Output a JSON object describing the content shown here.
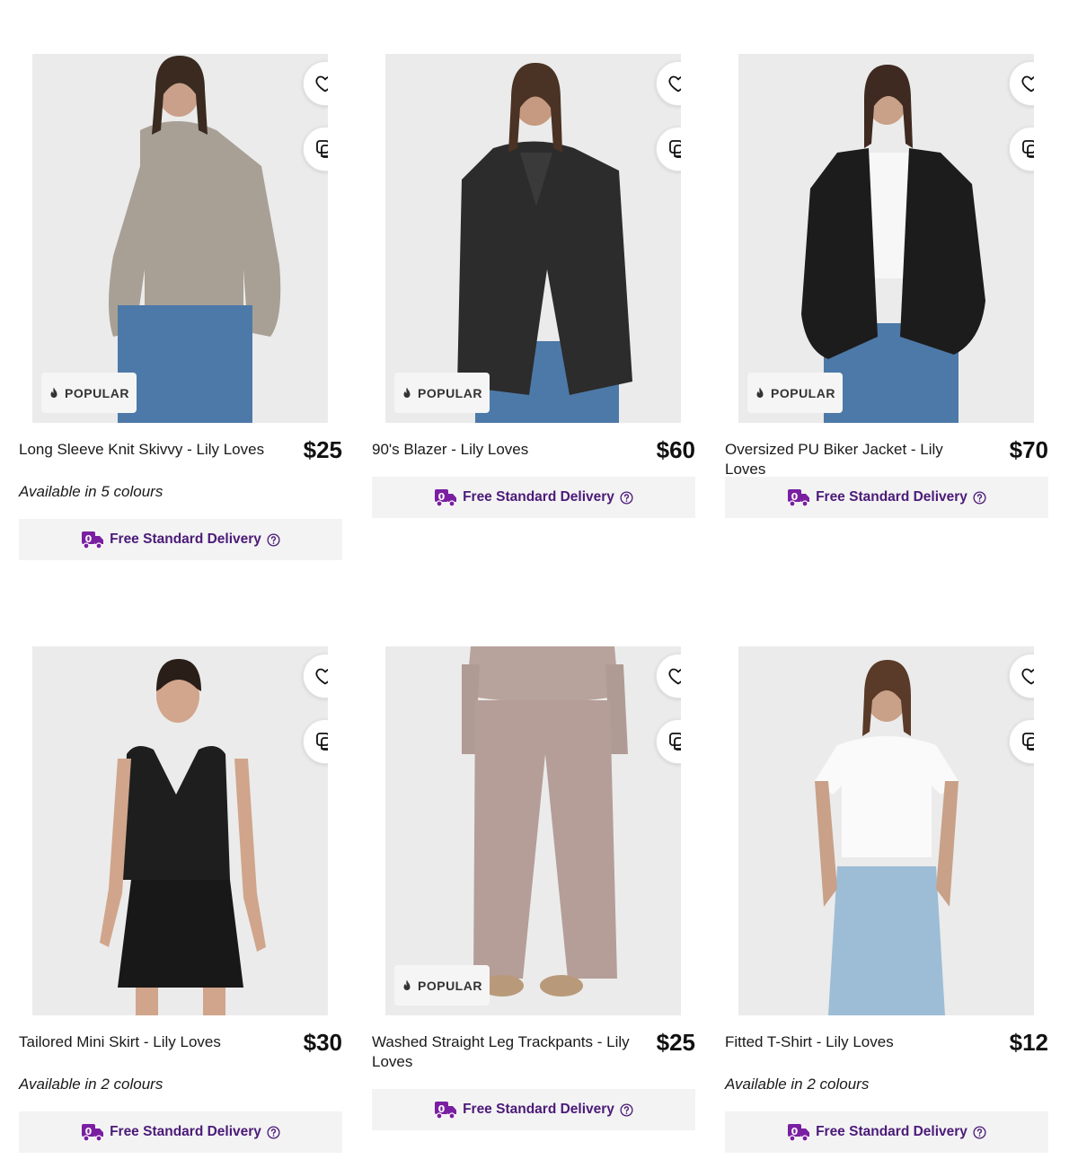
{
  "colors": {
    "delivery_purple": "#4b1a78",
    "delivery_icon": "#7a1fa2"
  },
  "products": [
    {
      "name": "Long Sleeve Knit Skivvy - Lily Loves",
      "price": "$25",
      "badge": "POPULAR",
      "colours": "Available in 5 colours",
      "delivery": "Free Standard Delivery",
      "icons": [
        "heart-icon",
        "compare-icon",
        "flame-icon",
        "delivery-truck-icon",
        "help-circle-icon"
      ]
    },
    {
      "name": "90's Blazer - Lily Loves",
      "price": "$60",
      "badge": "POPULAR",
      "colours": "",
      "delivery": "Free Standard Delivery",
      "icons": [
        "heart-icon",
        "compare-icon",
        "flame-icon",
        "delivery-truck-icon",
        "help-circle-icon"
      ]
    },
    {
      "name": "Oversized PU Biker Jacket - Lily Loves",
      "price": "$70",
      "badge": "POPULAR",
      "colours": "",
      "delivery": "Free Standard Delivery",
      "icons": [
        "heart-icon",
        "compare-icon",
        "flame-icon",
        "delivery-truck-icon",
        "help-circle-icon"
      ]
    },
    {
      "name": "Tailored Mini Skirt - Lily Loves",
      "price": "$30",
      "badge": "",
      "colours": "Available in 2 colours",
      "delivery": "Free Standard Delivery",
      "icons": [
        "heart-icon",
        "compare-icon",
        "delivery-truck-icon",
        "help-circle-icon"
      ]
    },
    {
      "name": "Washed Straight Leg Trackpants - Lily Loves",
      "price": "$25",
      "badge": "POPULAR",
      "colours": "",
      "delivery": "Free Standard Delivery",
      "icons": [
        "heart-icon",
        "compare-icon",
        "flame-icon",
        "delivery-truck-icon",
        "help-circle-icon"
      ]
    },
    {
      "name": "Fitted T-Shirt - Lily Loves",
      "price": "$12",
      "badge": "",
      "colours": "Available in 2 colours",
      "delivery": "Free Standard Delivery",
      "icons": [
        "heart-icon",
        "compare-icon",
        "delivery-truck-icon",
        "help-circle-icon"
      ]
    }
  ]
}
